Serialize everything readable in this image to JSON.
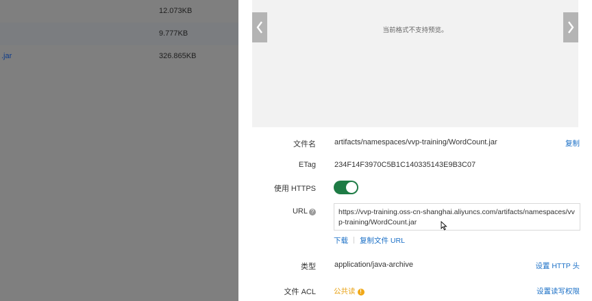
{
  "file_list": {
    "rows": [
      {
        "name": "",
        "size": "12.073KB"
      },
      {
        "name": "",
        "size": "9.777KB"
      },
      {
        "name": ".jar",
        "size": "326.865KB"
      }
    ]
  },
  "preview": {
    "message": "当前格式不支持预览。"
  },
  "details": {
    "filename": {
      "label": "文件名",
      "value": "artifacts/namespaces/vvp-training/WordCount.jar",
      "action": "复制"
    },
    "etag": {
      "label": "ETag",
      "value": "234F14F3970C5B1C140335143E9B3C07"
    },
    "https": {
      "label": "使用 HTTPS",
      "enabled": true
    },
    "url": {
      "label": "URL",
      "value": "https://vvp-training.oss-cn-shanghai.aliyuncs.com/artifacts/namespaces/vvp-training/WordCount.jar",
      "download": "下载",
      "copy_url": "复制文件 URL"
    },
    "type": {
      "label": "类型",
      "value": "application/java-archive",
      "action": "设置 HTTP 头"
    },
    "acl": {
      "label": "文件 ACL",
      "value": "公共读",
      "action": "设置读写权限"
    }
  },
  "colors": {
    "overlay": "#7f7f7f",
    "link": "#1a6fc6",
    "toggle_on": "#1e7b45",
    "warning": "#e8a317"
  }
}
